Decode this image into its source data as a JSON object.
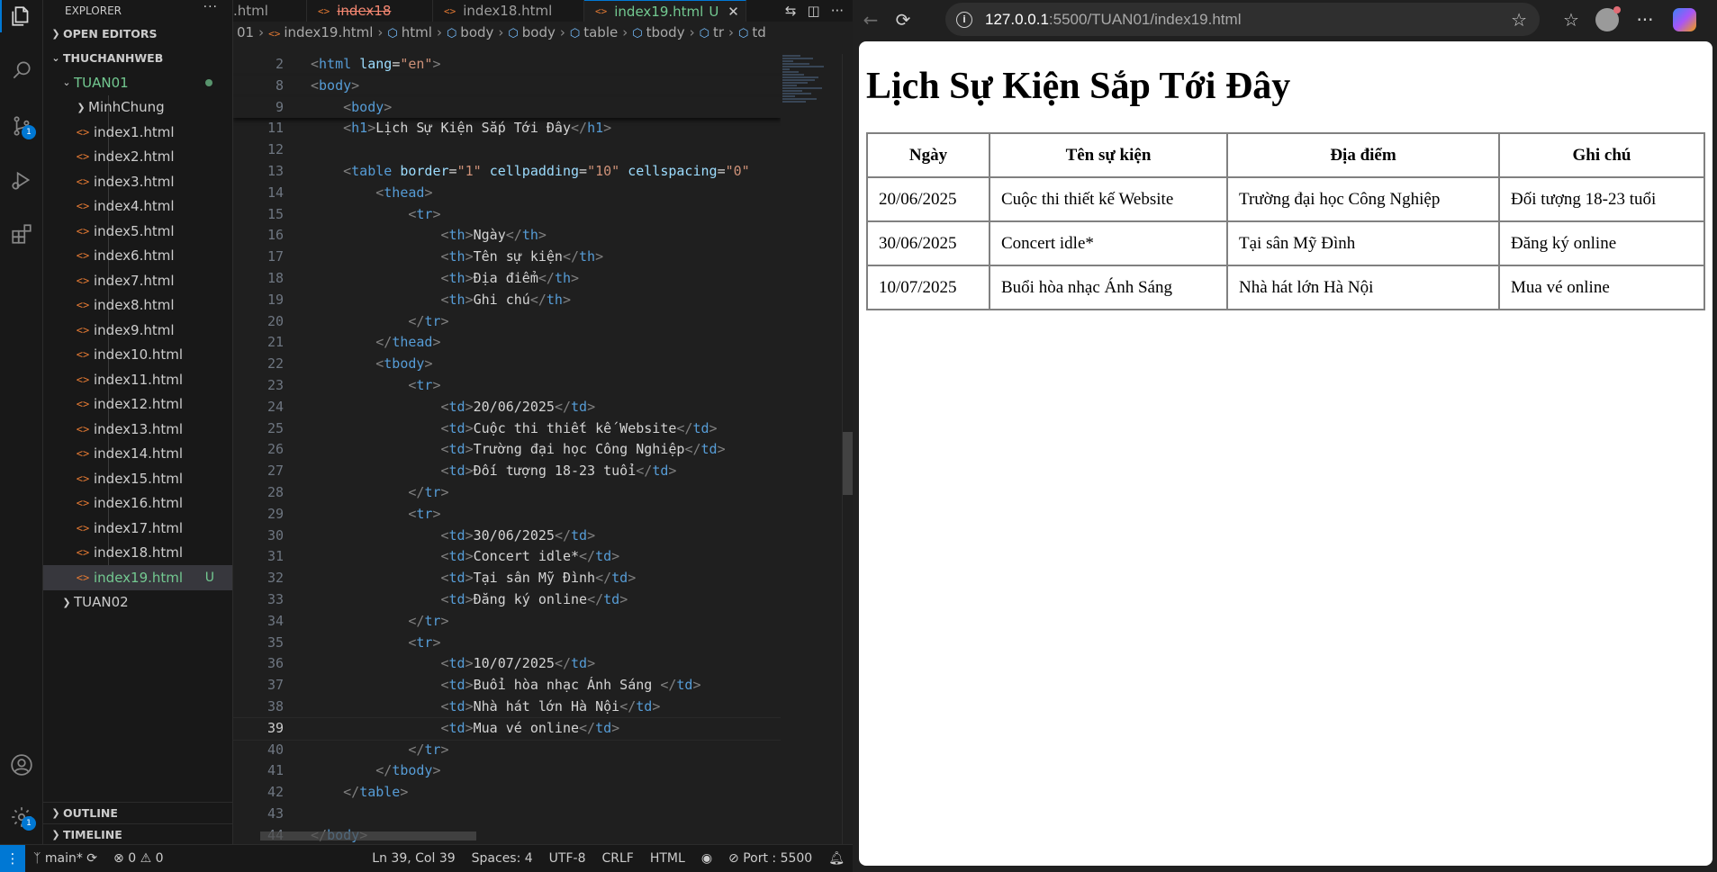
{
  "vscode": {
    "activity_badges": {
      "source_control": "1",
      "settings": "1"
    },
    "sidebar": {
      "title": "EXPLORER",
      "more": "···",
      "open_editors": "OPEN EDITORS",
      "workspace": "THUCHANHWEB",
      "folder_open": "TUAN01",
      "items": [
        {
          "name": "MinhChung",
          "type": "folder"
        },
        {
          "name": "index1.html",
          "type": "file"
        },
        {
          "name": "index2.html",
          "type": "file"
        },
        {
          "name": "index3.html",
          "type": "file"
        },
        {
          "name": "index4.html",
          "type": "file"
        },
        {
          "name": "index5.html",
          "type": "file"
        },
        {
          "name": "index6.html",
          "type": "file"
        },
        {
          "name": "index7.html",
          "type": "file"
        },
        {
          "name": "index8.html",
          "type": "file"
        },
        {
          "name": "index9.html",
          "type": "file"
        },
        {
          "name": "index10.html",
          "type": "file"
        },
        {
          "name": "index11.html",
          "type": "file"
        },
        {
          "name": "index12.html",
          "type": "file"
        },
        {
          "name": "index13.html",
          "type": "file"
        },
        {
          "name": "index14.html",
          "type": "file"
        },
        {
          "name": "index15.html",
          "type": "file"
        },
        {
          "name": "index16.html",
          "type": "file"
        },
        {
          "name": "index17.html",
          "type": "file"
        },
        {
          "name": "index18.html",
          "type": "file"
        },
        {
          "name": "index19.html",
          "type": "file",
          "status": "U"
        }
      ],
      "folder_closed": "TUAN02",
      "outline": "OUTLINE",
      "timeline": "TIMELINE"
    },
    "tabs": [
      {
        "label": ".html",
        "state": "normal"
      },
      {
        "label": "index18",
        "state": "error"
      },
      {
        "label": "index18.html",
        "state": "normal"
      },
      {
        "label": "index19.html",
        "status": "U",
        "state": "active"
      }
    ],
    "breadcrumb": [
      "01",
      "index19.html",
      "html",
      "body",
      "body",
      "table",
      "tbody",
      "tr",
      "td"
    ],
    "code_lines": [
      {
        "n": "2"
      },
      {
        "n": "8"
      },
      {
        "n": "9"
      },
      {
        "n": "11"
      },
      {
        "n": "12"
      },
      {
        "n": "13"
      },
      {
        "n": "14"
      },
      {
        "n": "15"
      },
      {
        "n": "16"
      },
      {
        "n": "17"
      },
      {
        "n": "18"
      },
      {
        "n": "19"
      },
      {
        "n": "20"
      },
      {
        "n": "21"
      },
      {
        "n": "22"
      },
      {
        "n": "23"
      },
      {
        "n": "24"
      },
      {
        "n": "25"
      },
      {
        "n": "26"
      },
      {
        "n": "27"
      },
      {
        "n": "28"
      },
      {
        "n": "29"
      },
      {
        "n": "30"
      },
      {
        "n": "31"
      },
      {
        "n": "32"
      },
      {
        "n": "33"
      },
      {
        "n": "34"
      },
      {
        "n": "35"
      },
      {
        "n": "36"
      },
      {
        "n": "37"
      },
      {
        "n": "38"
      },
      {
        "n": "39"
      },
      {
        "n": "40"
      },
      {
        "n": "41"
      },
      {
        "n": "42"
      },
      {
        "n": "43"
      },
      {
        "n": "44"
      }
    ],
    "code": {
      "lang_value": "\"en\"",
      "h1_text": "Lịch Sự Kiện Sắp Tới Đây",
      "table_attrs": {
        "border": "\"1\"",
        "cellpadding": "\"10\"",
        "cellspacing": "\"0\""
      },
      "th": [
        "Ngày",
        "Tên sự kiện",
        "Địa điểm",
        "Ghi chú"
      ],
      "rows": [
        [
          "20/06/2025",
          "Cuộc thi thiết kế Website",
          "Trường đại học Công Nghiệp",
          "Đối tượng 18-23 tuổi"
        ],
        [
          "30/06/2025",
          "Concert idle*",
          "Tại sân Mỹ Đình",
          "Đăng ký online"
        ],
        [
          "10/07/2025",
          "Buổi hòa nhạc Ánh Sáng ",
          "Nhà hát lớn Hà Nội",
          "Mua vé online"
        ]
      ]
    },
    "statusbar": {
      "branch": "main*",
      "errors": "0",
      "warnings": "0",
      "position": "Ln 39, Col 39",
      "spaces": "Spaces: 4",
      "encoding": "UTF-8",
      "eol": "CRLF",
      "language": "HTML",
      "port": "Port : 5500"
    }
  },
  "browser": {
    "url_host": "127.0.0.1",
    "url_path": ":5500/TUAN01/index19.html",
    "page": {
      "title": "Lịch Sự Kiện Sắp Tới Đây",
      "headers": [
        "Ngày",
        "Tên sự kiện",
        "Địa điểm",
        "Ghi chú"
      ],
      "rows": [
        [
          "20/06/2025",
          "Cuộc thi thiết kế Website",
          "Trường đại học Công Nghiệp",
          "Đối tượng 18-23 tuổi"
        ],
        [
          "30/06/2025",
          "Concert idle*",
          "Tại sân Mỹ Đình",
          "Đăng ký online"
        ],
        [
          "10/07/2025",
          "Buổi hòa nhạc Ánh Sáng",
          "Nhà hát lớn Hà Nội",
          "Mua vé online"
        ]
      ]
    }
  },
  "colors": {
    "accent": "#0078d4",
    "modified": "#73c991",
    "file_icon": "#e37933",
    "tag": "#569cd6",
    "attr": "#9cdcfe",
    "string": "#ce9178"
  }
}
